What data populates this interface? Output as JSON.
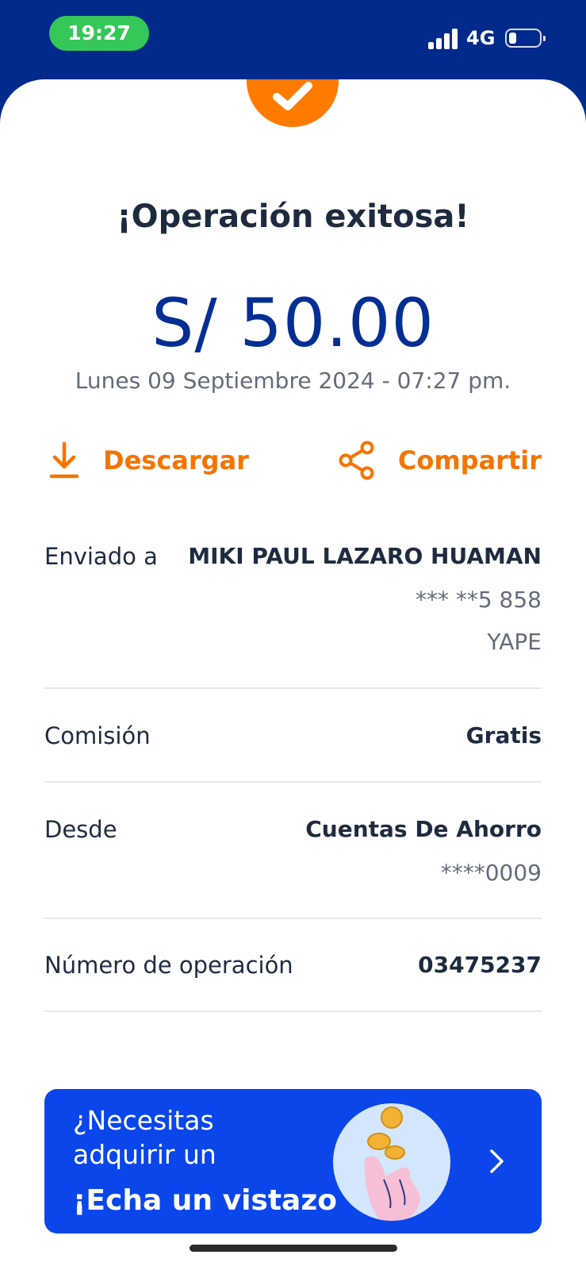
{
  "status_bar": {
    "time": "19:27",
    "network": "4G",
    "battery_level": 0.2
  },
  "receipt": {
    "title": "¡Operación exitosa!",
    "amount": "S/ 50.00",
    "datetime": "Lunes 09 Septiembre 2024 - 07:27 pm.",
    "actions": {
      "download_label": "Descargar",
      "share_label": "Compartir"
    },
    "sent_to": {
      "label": "Enviado a",
      "name": "MIKI PAUL LAZARO HUAMAN",
      "phone": "*** **5 858",
      "app": "YAPE"
    },
    "fee": {
      "label": "Comisión",
      "value": "Gratis"
    },
    "from": {
      "label": "Desde",
      "account": "Cuentas De Ahorro",
      "number": "****0009"
    },
    "operation": {
      "label": "Número de operación",
      "value": "03475237"
    }
  },
  "promo": {
    "line1": "¿Necesitas",
    "line2": "adquirir un",
    "cta": "¡Echa un vistazo"
  },
  "colors": {
    "brand_blue": "#022a8c",
    "accent_orange": "#f57400",
    "promo_blue": "#0b46ea",
    "success_green": "#36c759"
  }
}
